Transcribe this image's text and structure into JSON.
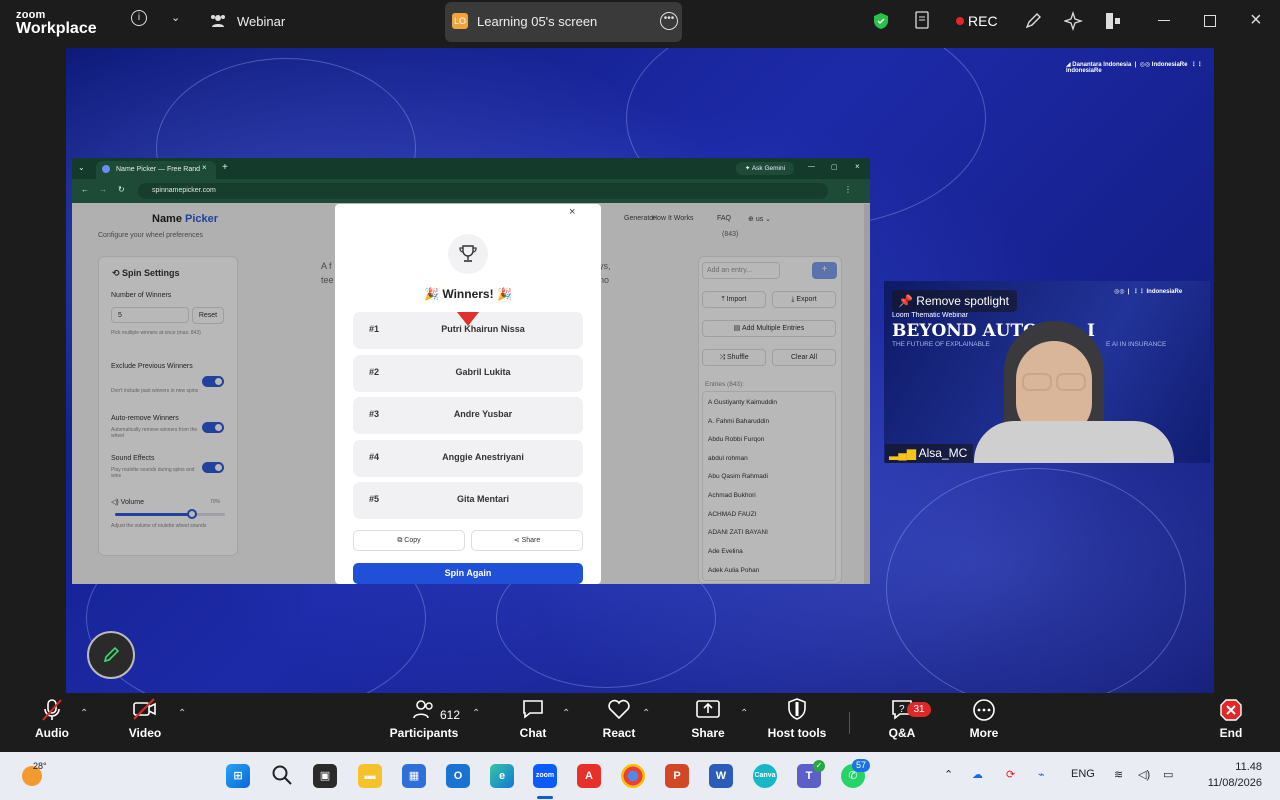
{
  "zoom": {
    "brand_top": "zoom",
    "brand_bottom": "Workplace",
    "meeting_type": "Webinar",
    "shared_screen_avatar": "LO",
    "shared_screen_label": "Learning 05's screen",
    "rec_label": "REC"
  },
  "stage": {
    "pencil_icon": "pencil-icon"
  },
  "browser": {
    "tab_title": "Name Picker — Free Rand",
    "ask_gemini": "Ask Gemini",
    "url": "spinnamepicker.com"
  },
  "site": {
    "logo_a": "Name",
    "logo_b": "Picker",
    "nav_generator": "Generator",
    "nav_how": "How It Works",
    "nav_faq": "FAQ",
    "nav_lang": "us",
    "configure_text": "Configure your wheel preferences",
    "spin_settings": "Spin Settings",
    "num_winners_label": "Number of Winners",
    "num_winners_value": "5",
    "reset": "Reset",
    "num_winners_hint": "Pick multiple winners at once (max: 843)",
    "exclude_label": "Exclude Previous Winners",
    "exclude_hint": "Don't include past winners in new spins",
    "auto_remove_label": "Auto-remove Winners",
    "auto_remove_hint": "Automatically remove winners from the wheel",
    "sound_label": "Sound Effects",
    "sound_hint": "Play roulette sounds during spins and wins",
    "volume_label": "Volume",
    "volume_value": "70%",
    "volume_level": 0.7,
    "volume_hint": "Adjust the volume of roulette wheel sounds",
    "bg_text_a": "A f",
    "bg_text_b": "tee",
    "bg_text_c": "ys,",
    "bg_text_d": "no",
    "count_top": "(843)",
    "add_entry_placeholder": "Add an entry...",
    "import": "Import",
    "export": "Export",
    "add_multiple": "Add Multiple Entries",
    "shuffle": "Shuffle",
    "clear_all": "Clear All",
    "entries_label": "Entries (843):",
    "entries": [
      "A Gustiyanty Kaimuddin",
      "A. Fahmi Baharuddin",
      "Abdu Robbi Furqon",
      "abdul rohman",
      "Abu Qasim Rahmadi",
      "Achmad Bukhori",
      "ACHMAD FAUZI",
      "ADANI ZATI BAYANI",
      "Ade Evelina",
      "Adek Aulia Pohan"
    ]
  },
  "modal": {
    "close": "×",
    "heading": "Winners!",
    "party_left": "🎉",
    "party_right": "🎉",
    "winners": [
      {
        "rank": "#1",
        "name": "Putri Khairun Nissa"
      },
      {
        "rank": "#2",
        "name": "Gabril Lukita"
      },
      {
        "rank": "#3",
        "name": "Andre Yusbar"
      },
      {
        "rank": "#4",
        "name": "Anggie Anestriyani"
      },
      {
        "rank": "#5",
        "name": "Gita Mentari"
      }
    ],
    "copy": "Copy",
    "share": "Share",
    "spin_again": "Spin Again"
  },
  "video": {
    "remove_spotlight": "Remove spotlight",
    "banner_small": "Loom Thematic Webinar",
    "banner_title": "BEYOND AUTOM",
    "banner_title_end": "I",
    "banner_sub": "THE FUTURE OF EXPLAINABLE",
    "banner_sub_end": "E AI IN INSURANCE",
    "participant_name": "Alsa_MC"
  },
  "controls": {
    "audio": "Audio",
    "video": "Video",
    "participants": "Participants",
    "participants_count": "612",
    "chat": "Chat",
    "react": "React",
    "share": "Share",
    "host_tools": "Host tools",
    "qa": "Q&A",
    "qa_badge": "31",
    "more": "More",
    "end": "End"
  },
  "taskbar": {
    "weather": "28°",
    "lang": "ENG",
    "time": "11.48",
    "date": "11/08/2026",
    "whatsapp_badge": "57",
    "zoom_label": "zoom"
  },
  "colors": {
    "accent_blue": "#2050d8",
    "rec_red": "#e02828",
    "shield_green": "#27c24c"
  }
}
